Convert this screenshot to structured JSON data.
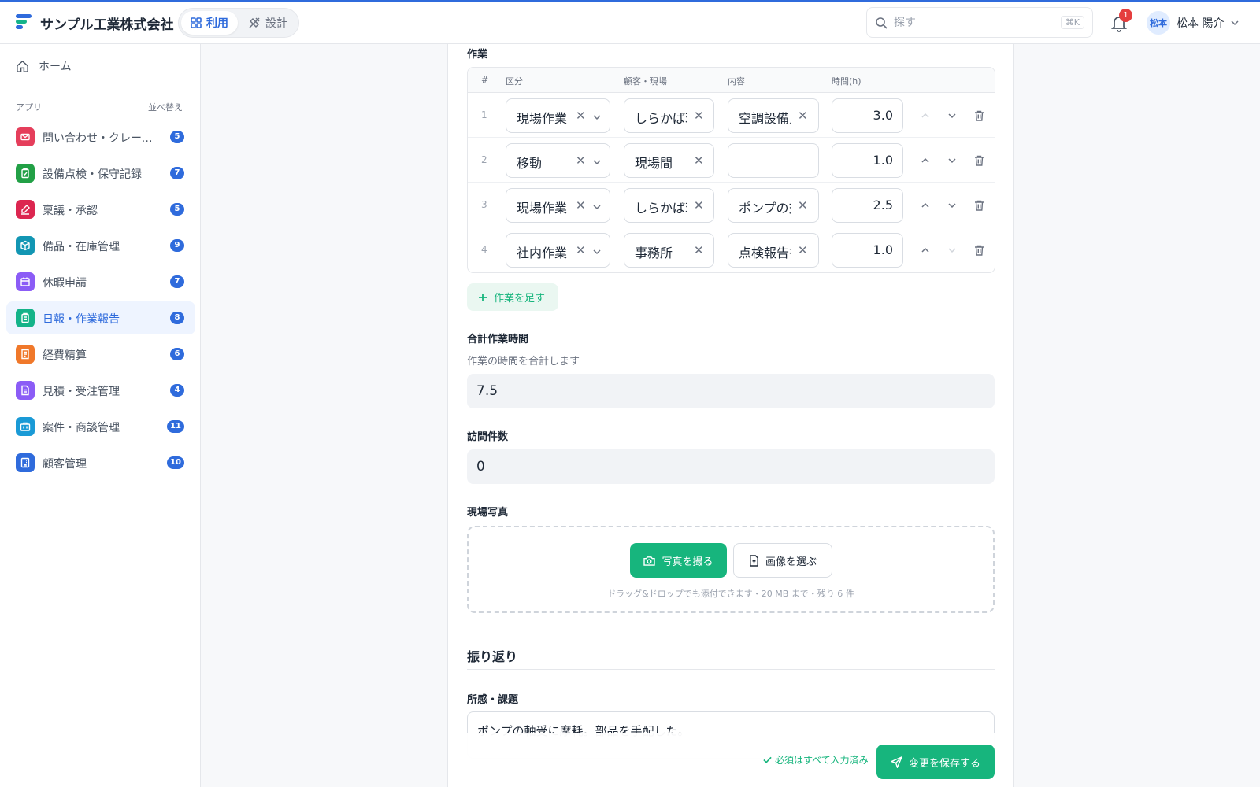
{
  "header": {
    "company": "サンプル工業株式会社",
    "mode_use": "利用",
    "mode_design": "設計",
    "search_placeholder": "探す",
    "search_shortcut": "⌘K",
    "notification_count": "1",
    "avatar_text": "松本",
    "user_name": "松本 陽介"
  },
  "sidebar": {
    "home": "ホーム",
    "apps_title": "アプリ",
    "sort_label": "並べ替え",
    "items": [
      {
        "label": "問い合わせ・クレーム管理",
        "count": "5",
        "color": "#e53e5b",
        "icon": "mail-icon"
      },
      {
        "label": "設備点検・保守記録",
        "count": "7",
        "color": "#22a046",
        "icon": "clipboard-check-icon"
      },
      {
        "label": "稟議・承認",
        "count": "5",
        "color": "#dc2650",
        "icon": "stamp-icon"
      },
      {
        "label": "備品・在庫管理",
        "count": "9",
        "color": "#1296b3",
        "icon": "box-icon"
      },
      {
        "label": "休暇申請",
        "count": "7",
        "color": "#8b5cf6",
        "icon": "calendar-icon"
      },
      {
        "label": "日報・作業報告",
        "count": "8",
        "color": "#14b389",
        "icon": "clipboard-icon"
      },
      {
        "label": "経費精算",
        "count": "6",
        "color": "#f0782a",
        "icon": "receipt-icon"
      },
      {
        "label": "見積・受注管理",
        "count": "4",
        "color": "#8b5cf6",
        "icon": "document-icon"
      },
      {
        "label": "案件・商談管理",
        "count": "11",
        "color": "#1a9ad6",
        "icon": "briefcase-icon"
      },
      {
        "label": "顧客管理",
        "count": "10",
        "color": "#2f6bdc",
        "icon": "building-icon"
      }
    ],
    "active_index": 5
  },
  "work": {
    "label": "作業",
    "columns": [
      "#",
      "区分",
      "顧客・現場",
      "内容",
      "時間(h)"
    ],
    "rows": [
      {
        "no": "1",
        "kubun": "現場作業",
        "kokyaku": "しらかば荘",
        "naiyo": "空調設備点検",
        "jikan": "3.0"
      },
      {
        "no": "2",
        "kubun": "移動",
        "kokyaku": "現場間",
        "naiyo": "",
        "jikan": "1.0"
      },
      {
        "no": "3",
        "kubun": "現場作業",
        "kokyaku": "しらかば荘",
        "naiyo": "ポンプの交換",
        "jikan": "2.5"
      },
      {
        "no": "4",
        "kubun": "社内作業",
        "kokyaku": "事務所",
        "naiyo": "点検報告書",
        "jikan": "1.0"
      }
    ],
    "add_label": "作業を足す"
  },
  "total": {
    "label": "合計作業時間",
    "help": "作業の時間を合計します",
    "value": "7.5"
  },
  "visits": {
    "label": "訪問件数",
    "value": "0"
  },
  "photos": {
    "label": "現場写真",
    "take_label": "写真を撮る",
    "choose_label": "画像を選ぶ",
    "hint": "ドラッグ&ドロップでも添付できます・20 MB まで・残り 6 件"
  },
  "review": {
    "title": "振り返り",
    "field_label": "所感・課題",
    "value": "ポンプの軸受に摩耗。部品を手配した。"
  },
  "footer": {
    "status": "必須はすべて入力済み",
    "save_label": "変更を保存する"
  },
  "colors": {
    "accent": "#2f6bdc",
    "success": "#17b57d",
    "badge": "#e53e3e"
  }
}
